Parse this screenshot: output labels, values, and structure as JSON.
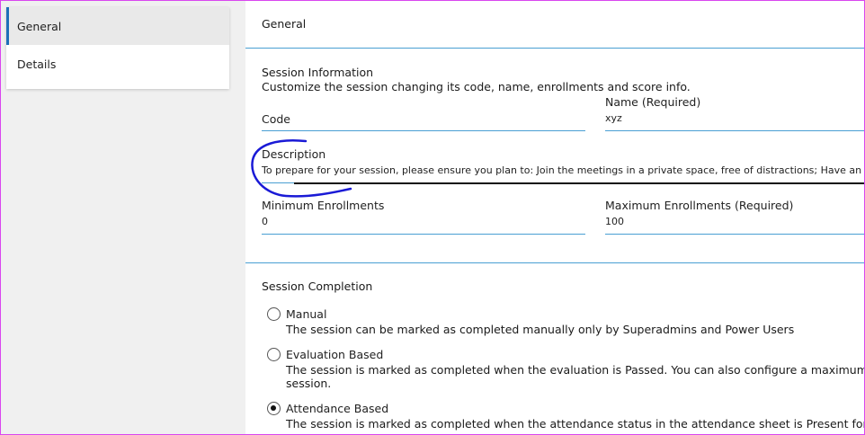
{
  "sidebar": {
    "items": [
      {
        "label": "General",
        "active": true
      },
      {
        "label": "Details",
        "active": false
      }
    ]
  },
  "main": {
    "header_title": "General",
    "session_info": {
      "title": "Session Information",
      "subtitle": "Customize the session changing its code, name, enrollments and score info.",
      "code": {
        "label": "Code",
        "value": ""
      },
      "name": {
        "label": "Name  (Required)",
        "value": "xyz"
      },
      "description": {
        "label": "Description",
        "value": "To prepare for your session, please ensure you plan to:  Join the meetings in a private space, free of distractions;   Have an excellent internet"
      },
      "min_enrollments": {
        "label": "Minimum Enrollments",
        "value": "0"
      },
      "max_enrollments": {
        "label": "Maximum Enrollments  (Required)",
        "value": "100"
      }
    },
    "completion": {
      "title": "Session Completion",
      "options": [
        {
          "label": "Manual",
          "desc": "The session can be marked as completed manually only by Superadmins and Power Users",
          "desc2": "",
          "selected": false
        },
        {
          "label": "Evaluation Based",
          "desc": "The session is marked as completed when the evaluation is Passed. You can also configure a maximum score for the",
          "desc2": "session.",
          "selected": false
        },
        {
          "label": "Attendance Based",
          "desc": "The session is marked as completed when the attendance status in the attendance sheet is Present for all the events",
          "desc2": "",
          "selected": true
        }
      ]
    }
  },
  "colors": {
    "accent": "#1e6fb8",
    "field_underline": "#4a9fd3",
    "annotation_stroke": "#1a1ad6",
    "frame": "#d946ef"
  }
}
